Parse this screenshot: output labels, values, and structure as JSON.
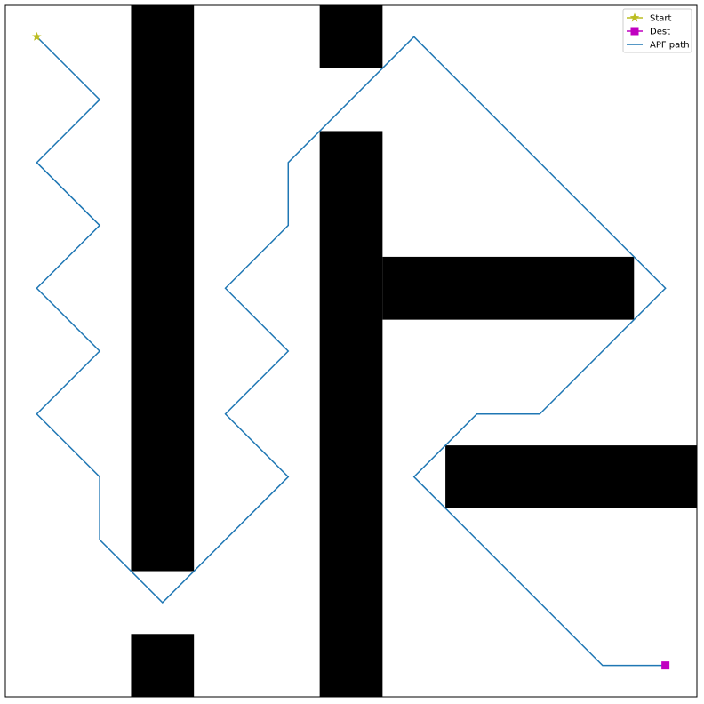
{
  "chart_data": {
    "type": "line",
    "title": "",
    "xlabel": "",
    "ylabel": "",
    "xlim": [
      0,
      22
    ],
    "ylim": [
      0,
      22
    ],
    "grid": false,
    "axis_ticks": false,
    "legend_position": "top-right",
    "obstacles": [
      {
        "x": 4,
        "y": 4,
        "w": 2,
        "h": 18
      },
      {
        "x": 4,
        "y": 0,
        "w": 2,
        "h": 2
      },
      {
        "x": 10,
        "y": 20,
        "w": 2,
        "h": 2
      },
      {
        "x": 10,
        "y": 0,
        "w": 2,
        "h": 18
      },
      {
        "x": 12,
        "y": 12,
        "w": 8,
        "h": 2
      },
      {
        "x": 14,
        "y": 6,
        "w": 8,
        "h": 2
      }
    ],
    "series": [
      {
        "name": "Start",
        "type": "point",
        "marker": "star",
        "color": "#bcbd22",
        "points": [
          [
            1,
            21
          ]
        ]
      },
      {
        "name": "Dest",
        "type": "point",
        "marker": "square",
        "color": "#c000c0",
        "points": [
          [
            21,
            1
          ]
        ]
      },
      {
        "name": "APF path",
        "type": "line",
        "color": "#1f77b4",
        "points": [
          [
            1,
            21
          ],
          [
            3,
            19
          ],
          [
            1,
            17
          ],
          [
            3,
            15
          ],
          [
            1,
            13
          ],
          [
            3,
            11
          ],
          [
            1,
            9
          ],
          [
            3,
            7
          ],
          [
            3,
            5
          ],
          [
            5,
            3
          ],
          [
            9,
            7
          ],
          [
            7,
            9
          ],
          [
            9,
            11
          ],
          [
            7,
            13
          ],
          [
            9,
            15
          ],
          [
            9,
            17
          ],
          [
            13,
            21
          ],
          [
            21,
            13
          ],
          [
            17,
            9
          ],
          [
            15,
            9
          ],
          [
            13,
            7
          ],
          [
            19,
            1
          ],
          [
            21,
            1
          ]
        ]
      }
    ]
  }
}
